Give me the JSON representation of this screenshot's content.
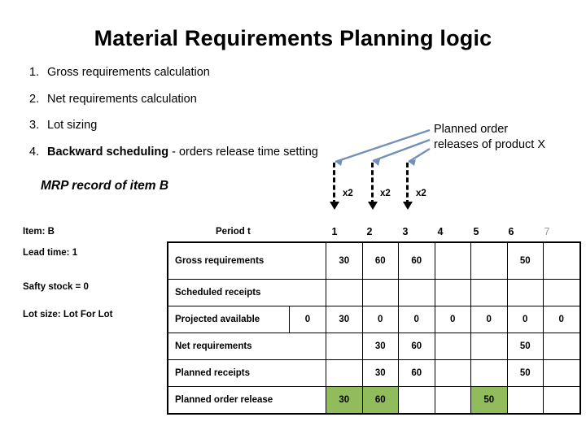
{
  "slide": {
    "title": "Material Requirements Planning logic",
    "bullets": [
      {
        "num": "1.",
        "text": "Gross requirements calculation",
        "bold_part": "",
        "rest": ""
      },
      {
        "num": "2.",
        "text": "Net requirements calculation",
        "bold_part": "",
        "rest": ""
      },
      {
        "num": "3.",
        "text": "Lot sizing",
        "bold_part": "",
        "rest": ""
      },
      {
        "num": "4.",
        "text": "Backward scheduling - orders release time setting",
        "bold_part": "Backward scheduling",
        "rest": " - orders release time setting"
      }
    ],
    "callout": {
      "line1": "Planned order",
      "line2": "releases of product X",
      "connector_color": "#7590b5"
    },
    "mrp_record_label": "MRP record  of item B",
    "multiplier_labels": [
      "x2",
      "x2",
      "x2"
    ],
    "side_info": {
      "item": "Item: B",
      "lead_time": "Lead time: 1",
      "safety_stock": "Safty stock = 0",
      "lot_size": "Lot size: Lot For Lot"
    },
    "accent_green": "#91bc5c"
  },
  "table": {
    "period_header": "Period t",
    "period_columns": [
      "1",
      "2",
      "3",
      "4",
      "5",
      "6",
      "7"
    ],
    "rows": [
      {
        "label": "Gross requirements",
        "lead_cell": null,
        "values": [
          "30",
          "60",
          "60",
          "",
          "",
          "50",
          ""
        ],
        "highlight": [
          false,
          false,
          false,
          false,
          false,
          false,
          false
        ]
      },
      {
        "label": "Scheduled receipts",
        "lead_cell": null,
        "values": [
          "",
          "",
          "",
          "",
          "",
          "",
          ""
        ],
        "highlight": [
          false,
          false,
          false,
          false,
          false,
          false,
          false
        ]
      },
      {
        "label": "Projected available",
        "lead_cell": "0",
        "values": [
          "30",
          "0",
          "0",
          "0",
          "0",
          "0",
          "0"
        ],
        "highlight": [
          false,
          false,
          false,
          false,
          false,
          false,
          false
        ]
      },
      {
        "label": "Net requirements",
        "lead_cell": null,
        "values": [
          "",
          "30",
          "60",
          "",
          "",
          "50",
          ""
        ],
        "highlight": [
          false,
          false,
          false,
          false,
          false,
          false,
          false
        ]
      },
      {
        "label": "Planned receipts",
        "lead_cell": null,
        "values": [
          "",
          "30",
          "60",
          "",
          "",
          "50",
          ""
        ],
        "highlight": [
          false,
          false,
          false,
          false,
          false,
          false,
          false
        ]
      },
      {
        "label": "Planned order release",
        "lead_cell": null,
        "values": [
          "30",
          "60",
          "",
          "",
          "50",
          "",
          ""
        ],
        "highlight": [
          true,
          true,
          false,
          false,
          true,
          false,
          false
        ]
      }
    ]
  }
}
